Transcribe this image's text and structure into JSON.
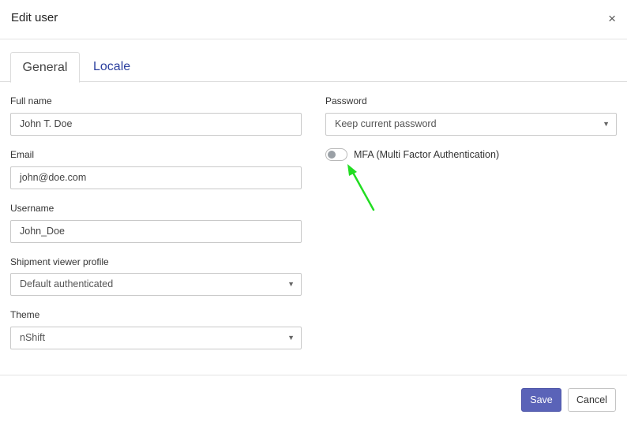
{
  "dialog": {
    "title": "Edit user",
    "close_glyph": "×"
  },
  "tabs": [
    {
      "label": "General",
      "active": true
    },
    {
      "label": "Locale",
      "active": false
    }
  ],
  "form": {
    "full_name": {
      "label": "Full name",
      "value": "John T. Doe"
    },
    "email": {
      "label": "Email",
      "value": "john@doe.com"
    },
    "username": {
      "label": "Username",
      "value": "John_Doe"
    },
    "shipment_viewer_profile": {
      "label": "Shipment viewer profile",
      "value": "Default authenticated"
    },
    "theme": {
      "label": "Theme",
      "value": "nShift"
    },
    "password": {
      "label": "Password",
      "value": "Keep current password"
    },
    "mfa": {
      "label": "MFA (Multi Factor Authentication)",
      "enabled": false
    }
  },
  "footer": {
    "save_label": "Save",
    "cancel_label": "Cancel"
  },
  "colors": {
    "primary": "#5a63b8",
    "tab_link": "#2b3f9e",
    "annotation_arrow": "#22dd22"
  },
  "icons": {
    "close": "close-icon",
    "dropdown": "chevron-down-icon",
    "arrow": "annotation-arrow-icon"
  }
}
